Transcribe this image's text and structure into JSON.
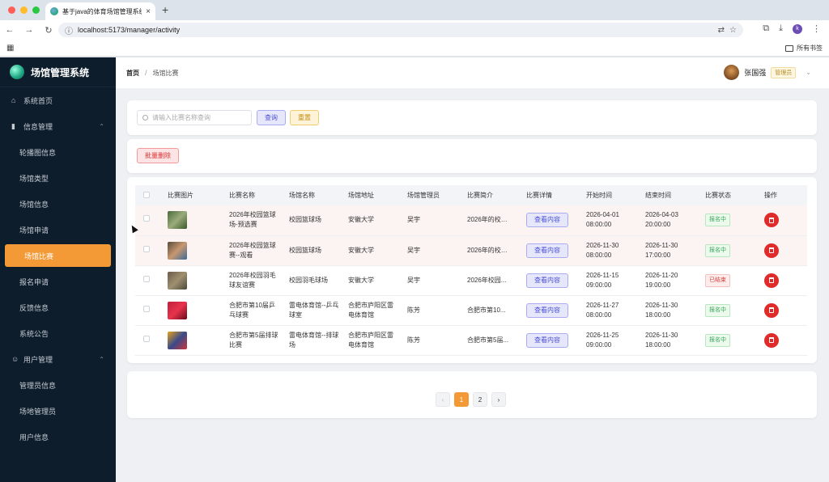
{
  "browser": {
    "traffic_lights": [
      "#ff5f57",
      "#febc2e",
      "#28c840"
    ],
    "tab_title": "基于java的体育场馆管理系统设",
    "tab_close": "×",
    "new_tab": "+",
    "url": "localhost:5173/manager/activity",
    "bookmarks_folder": "所有书签",
    "profile_initial": "k"
  },
  "sidebar": {
    "app_title": "场馆管理系统",
    "items": [
      {
        "label": "系统首页",
        "type": "top",
        "icon": "home-icon"
      },
      {
        "label": "信息管理",
        "type": "group",
        "icon": "chart-icon"
      },
      {
        "label": "轮播图信息",
        "type": "sub"
      },
      {
        "label": "场馆类型",
        "type": "sub"
      },
      {
        "label": "场馆信息",
        "type": "sub"
      },
      {
        "label": "场馆申请",
        "type": "sub"
      },
      {
        "label": "场馆比赛",
        "type": "sub",
        "active": true
      },
      {
        "label": "报名申请",
        "type": "sub"
      },
      {
        "label": "反馈信息",
        "type": "sub"
      },
      {
        "label": "系统公告",
        "type": "sub"
      },
      {
        "label": "用户管理",
        "type": "group",
        "icon": "user-icon"
      },
      {
        "label": "管理员信息",
        "type": "sub"
      },
      {
        "label": "场地管理员",
        "type": "sub"
      },
      {
        "label": "用户信息",
        "type": "sub"
      }
    ]
  },
  "header": {
    "breadcrumb_home": "首页",
    "breadcrumb_sep": "/",
    "breadcrumb_current": "场馆比赛",
    "username": "张国强",
    "role": "管理员"
  },
  "filters": {
    "search_placeholder": "请输入比赛名称查询",
    "query_label": "查询",
    "reset_label": "重置",
    "batch_delete_label": "批量删除"
  },
  "table": {
    "columns": [
      "比赛图片",
      "比赛名称",
      "场馆名称",
      "场馆地址",
      "场馆管理员",
      "比赛简介",
      "比赛详情",
      "开始时间",
      "结束时间",
      "比赛状态",
      "操作"
    ],
    "detail_label": "查看内容",
    "rows": [
      {
        "name": "2026年校园篮球场-预选赛",
        "venue": "校园篮球场",
        "address": "安徽大学",
        "manager": "吴宇",
        "intro": "2026年的校园...",
        "start": "2026-04-01 08:00:00",
        "end": "2026-04-03 20:00:00",
        "status": "报名中",
        "status_kind": "open"
      },
      {
        "name": "2026年校园篮球赛--观看",
        "venue": "校园篮球场",
        "address": "安徽大学",
        "manager": "吴宇",
        "intro": "2026年的校园...",
        "start": "2026-11-30 08:00:00",
        "end": "2026-11-30 17:00:00",
        "status": "报名中",
        "status_kind": "open"
      },
      {
        "name": "2026年校园羽毛球友谊赛",
        "venue": "校园羽毛球场",
        "address": "安徽大学",
        "manager": "吴宇",
        "intro": "2026年校园...",
        "start": "2026-11-15 09:00:00",
        "end": "2026-11-20 19:00:00",
        "status": "已结束",
        "status_kind": "end"
      },
      {
        "name": "合肥市第10届乒乓球赛",
        "venue": "雷电体育馆--乒乓球室",
        "address": "合肥市庐阳区雷电体育馆",
        "manager": "陈芳",
        "intro": "合肥市第10...",
        "start": "2026-11-27 08:00:00",
        "end": "2026-11-30 18:00:00",
        "status": "报名中",
        "status_kind": "open"
      },
      {
        "name": "合肥市第5届排球比赛",
        "venue": "雷电体育馆--排球场",
        "address": "合肥市庐阳区雷电体育馆",
        "manager": "陈芳",
        "intro": "合肥市第5届...",
        "start": "2026-11-25 09:00:00",
        "end": "2026-11-30 18:00:00",
        "status": "报名中",
        "status_kind": "open"
      }
    ]
  },
  "pagination": {
    "prev": "‹",
    "pages": [
      "1",
      "2"
    ],
    "current": "1",
    "next": "›"
  },
  "colors": {
    "sidebar_bg": "#0d1d2c",
    "accent": "#f39a36",
    "danger": "#e02b2b",
    "primary_btn": "#4a4fd6"
  }
}
